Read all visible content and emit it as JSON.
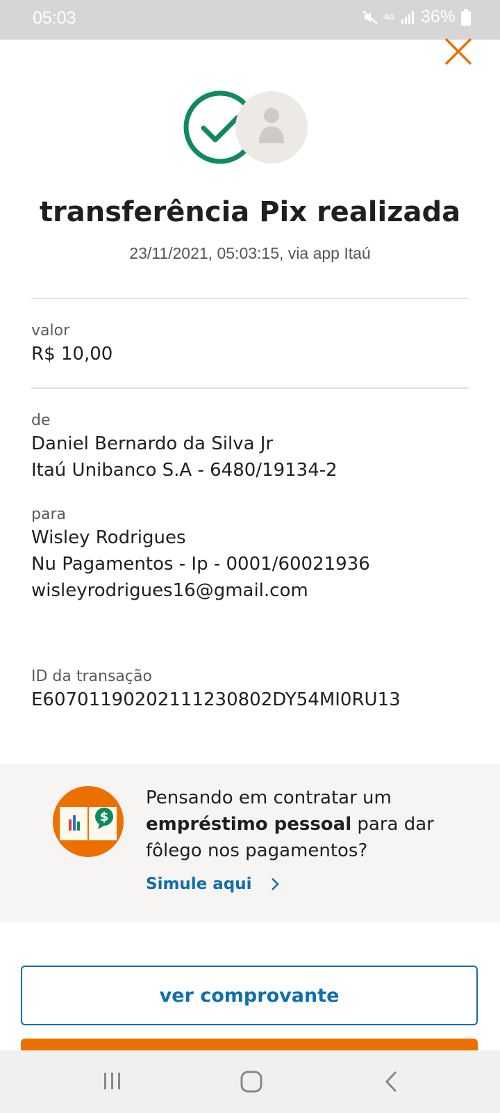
{
  "status_bar": {
    "time": "05:03",
    "network": "4G",
    "battery": "36%"
  },
  "header": {
    "close_icon": "close-icon",
    "accent_color": "#ec7000"
  },
  "success": {
    "title": "transferência Pix realizada",
    "subtitle": "23/11/2021,  05:03:15, via app Itaú",
    "check_color": "#0f8a5f"
  },
  "details": {
    "valor_label": "valor",
    "valor": "R$ 10,00",
    "de_label": "de",
    "de_name": "Daniel Bernardo da Silva Jr",
    "de_bank": "Itaú Unibanco S.A - 6480/19134-2",
    "para_label": "para",
    "para_name": "Wisley Rodrigues",
    "para_bank": "Nu Pagamentos - Ip - 0001/60021936",
    "para_email": "wisleyrodrigues16@gmail.com",
    "id_label": "ID da transação",
    "id_value": "E60701190202111230802DY54MI0RU13"
  },
  "promo": {
    "text_before": "Pensando em contratar um",
    "text_bold": "empréstimo pessoal",
    "text_after": " para dar fôlego nos pagamentos?",
    "link_label": "Simule aqui",
    "link_color": "#106eb0"
  },
  "actions": {
    "ver_comprovante": "ver comprovante"
  },
  "navbar": {
    "icons": [
      "recent-apps-icon",
      "home-icon",
      "back-icon"
    ]
  }
}
